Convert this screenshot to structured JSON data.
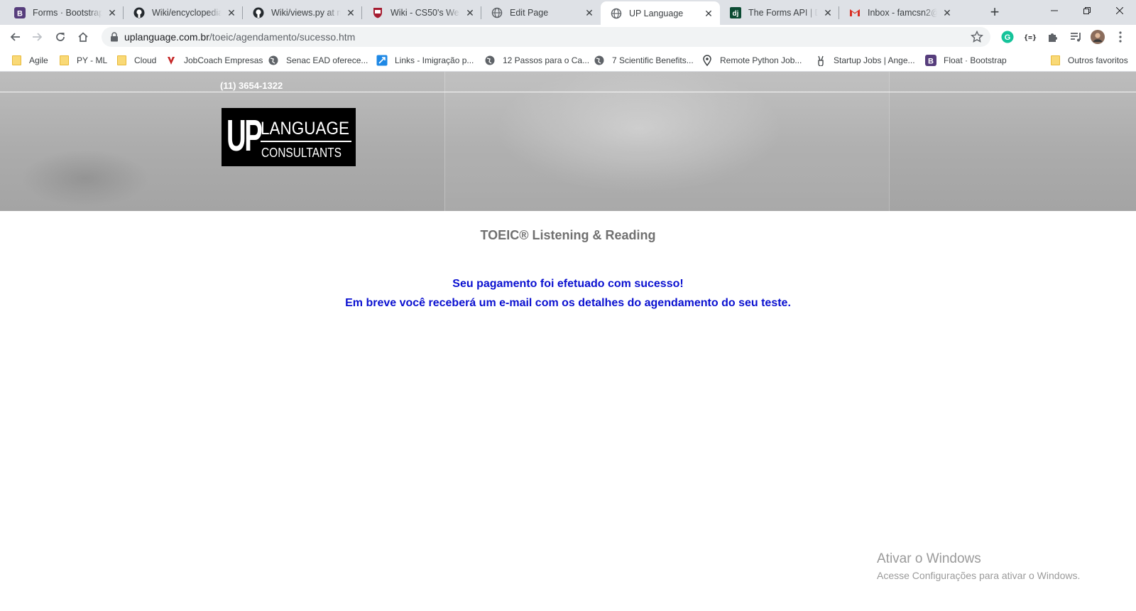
{
  "browser": {
    "tabs": [
      {
        "title": "Forms · Bootstrap",
        "icon": "bootstrap-icon"
      },
      {
        "title": "Wiki/encyclopedia at",
        "icon": "github-icon"
      },
      {
        "title": "Wiki/views.py at ma",
        "icon": "github-icon"
      },
      {
        "title": "Wiki - CS50's Web P",
        "icon": "harvard-shield-icon"
      },
      {
        "title": "Edit Page",
        "icon": "globe-icon"
      },
      {
        "title": "UP Language",
        "icon": "globe-icon",
        "active": true
      },
      {
        "title": "The Forms API | Djan",
        "icon": "django-icon"
      },
      {
        "title": "Inbox - famcsn2@g",
        "icon": "gmail-icon"
      }
    ],
    "new_tab": "+",
    "address": {
      "domain": "uplanguage.com.br",
      "path": "/toeic/agendamento/sucesso.htm"
    },
    "bookmarks": [
      {
        "label": "Agile",
        "icon": "folder-icon"
      },
      {
        "label": "PY - ML",
        "icon": "folder-icon"
      },
      {
        "label": "Cloud",
        "icon": "folder-icon"
      },
      {
        "label": "JobCoach Empresas",
        "icon": "jobcoach-icon"
      },
      {
        "label": "Senac EAD oferece...",
        "icon": "globe-icon"
      },
      {
        "label": "Links - Imigração p...",
        "icon": "link-icon"
      },
      {
        "label": "12 Passos para o Ca...",
        "icon": "globe-icon"
      },
      {
        "label": "7 Scientific Benefits...",
        "icon": "globe-icon"
      },
      {
        "label": "Remote Python Job...",
        "icon": "location-pin-icon"
      },
      {
        "label": "Startup Jobs | Ange...",
        "icon": "peace-hand-icon"
      },
      {
        "label": "Float · Bootstrap",
        "icon": "bootstrap-icon"
      },
      {
        "label": "Outros favoritos",
        "icon": "folder-icon"
      }
    ]
  },
  "page": {
    "phone": "(11) 3654-1322",
    "logo": {
      "big": "UP",
      "line1": "LANGUAGE",
      "line2": "CONSULTANTS"
    },
    "title": "TOEIC® Listening & Reading",
    "message_line1": "Seu pagamento foi efetuado com sucesso!",
    "message_line2": "Em breve você receberá um e-mail com os detalhes do agendamento do seu teste."
  },
  "watermark": {
    "title": "Ativar o Windows",
    "subtitle": "Acesse Configurações para ativar o Windows."
  },
  "colors": {
    "message": "#0a10d0",
    "title": "#707070"
  }
}
